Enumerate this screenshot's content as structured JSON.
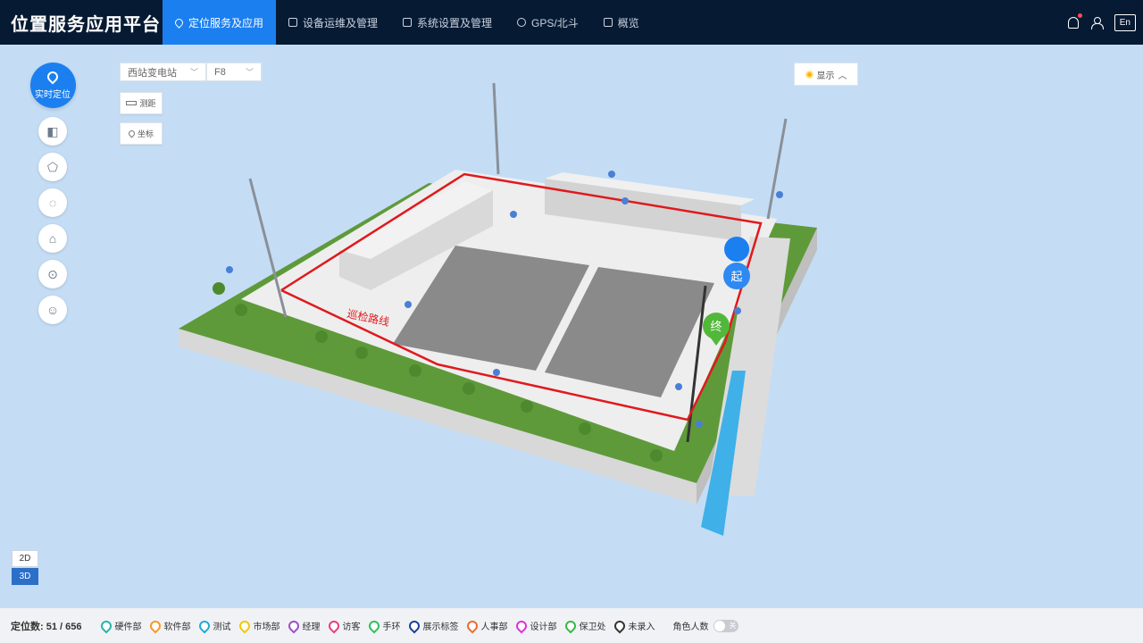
{
  "app": {
    "title": "位置服务应用平台",
    "nav": [
      {
        "label": "定位服务及应用",
        "icon": "location-icon",
        "active": true
      },
      {
        "label": "设备运维及管理",
        "icon": "device-icon",
        "active": false
      },
      {
        "label": "系统设置及管理",
        "icon": "settings-icon",
        "active": false
      },
      {
        "label": "GPS/北斗",
        "icon": "satellite-icon",
        "active": false
      },
      {
        "label": "概览",
        "icon": "overview-icon",
        "active": false
      }
    ],
    "lang": "En"
  },
  "tools": {
    "main_label": "实时定位",
    "items": [
      "camera-icon",
      "area-icon",
      "track-icon",
      "alarm-icon",
      "fence-icon",
      "person-icon"
    ]
  },
  "controls": {
    "station": "西站变电站",
    "floor": "F8",
    "measure": "测距",
    "coord": "坐标",
    "display": "显示",
    "dim_2d": "2D",
    "dim_3d": "3D"
  },
  "scene": {
    "route_label": "巡检路线",
    "start_label": "起",
    "end_label": "终"
  },
  "bottom": {
    "count_label": "定位数: 51 / 656",
    "legend": [
      {
        "label": "硬件部",
        "color": "#26b5a8"
      },
      {
        "label": "软件部",
        "color": "#f59a23"
      },
      {
        "label": "测试",
        "color": "#20a9d8"
      },
      {
        "label": "市场部",
        "color": "#f0c808"
      },
      {
        "label": "经理",
        "color": "#9b4fc8"
      },
      {
        "label": "访客",
        "color": "#e83e7a"
      },
      {
        "label": "手环",
        "color": "#2fbf5a"
      },
      {
        "label": "展示标签",
        "color": "#1a3f9a"
      },
      {
        "label": "人事部",
        "color": "#f06a2d"
      },
      {
        "label": "设计部",
        "color": "#e030d8"
      },
      {
        "label": "保卫处",
        "color": "#3ab54a"
      },
      {
        "label": "未录入",
        "color": "#333333"
      }
    ],
    "role_label": "角色人数",
    "toggle_label": "关"
  }
}
